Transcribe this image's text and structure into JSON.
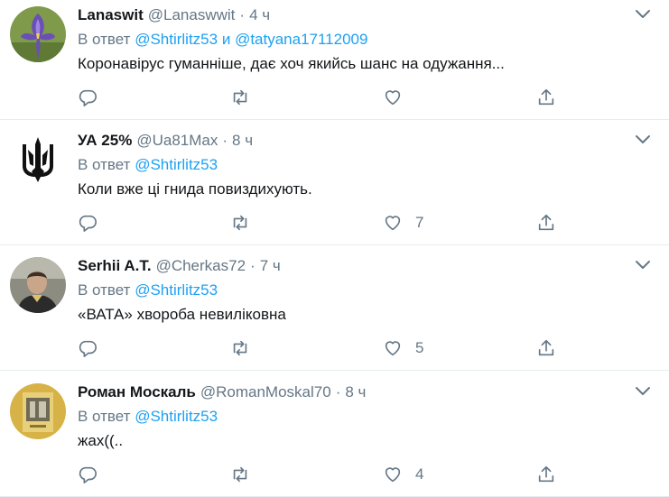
{
  "reply_prefix": "В ответ",
  "tweets": [
    {
      "name": "Lanaswit",
      "handle": "@Lanaswwit",
      "time": "4 ч",
      "mentions": [
        "@Shtirlitz53",
        "@tatyana17112009"
      ],
      "mention_joiner": "и",
      "text": "Коронавірус гуманніше, дає хоч якийсь шанс на одужання...",
      "likes": ""
    },
    {
      "name": "УА 25%",
      "handle": "@Ua81Max",
      "time": "8 ч",
      "mentions": [
        "@Shtirlitz53"
      ],
      "text": "Коли вже ці гнида повиздихують.",
      "likes": "7"
    },
    {
      "name": "Serhii A.T.",
      "handle": "@Cherkas72",
      "time": "7 ч",
      "mentions": [
        "@Shtirlitz53"
      ],
      "text": "«ВАТА» хвороба невиліковна",
      "likes": "5"
    },
    {
      "name": "Роман Москаль",
      "handle": "@RomanMoskal70",
      "time": "8 ч",
      "mentions": [
        "@Shtirlitz53"
      ],
      "text": "жах((..",
      "likes": "4"
    }
  ],
  "colors": {
    "accent": "#1da1f2",
    "secondary_text": "#657786",
    "divider": "#e6ecf0"
  },
  "icons": [
    "chevron-down-icon",
    "reply-icon",
    "retweet-icon",
    "like-icon",
    "share-icon"
  ]
}
